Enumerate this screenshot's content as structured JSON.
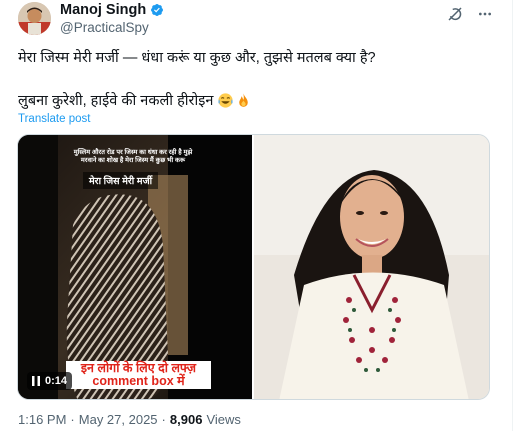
{
  "author": {
    "display_name": "Manoj Singh",
    "handle": "@PracticalSpy",
    "verified_icon": "verified-badge-icon",
    "avatar": "avatar"
  },
  "tweet": {
    "line1": "मेरा जिस्म मेरी मर्जी — धंधा करूं या कुछ और, तुझसे मतलब क्या है?",
    "line2": "लुबना कुरेशी, हाईवे की नकली हीरोइन",
    "emojis": [
      "face-with-tears-of-joy",
      "fire"
    ],
    "translate_label": "Translate post"
  },
  "video": {
    "caption_top": "मुस्लिम औरत रोड पर जिस्म का धंधा कर रही है मुझे मरवाने का शोख है मेरा जिस्म मैं कुछ भी करू",
    "caption_mid": "मेरा जिस मेरी मर्जी",
    "caption_bottom_line1": "इन लोगों के लिए दो लफ्ज़",
    "caption_bottom_line2": "comment box में",
    "duration": "0:14",
    "pause_icon": "pause-icon"
  },
  "meta": {
    "time": "1:16 PM",
    "separator": "·",
    "date": "May 27, 2025",
    "views_count": "8,906",
    "views_label": "Views"
  },
  "colors": {
    "accent": "#1d9bf0",
    "secondary_text": "#536471",
    "caption_red": "#e0241a"
  }
}
